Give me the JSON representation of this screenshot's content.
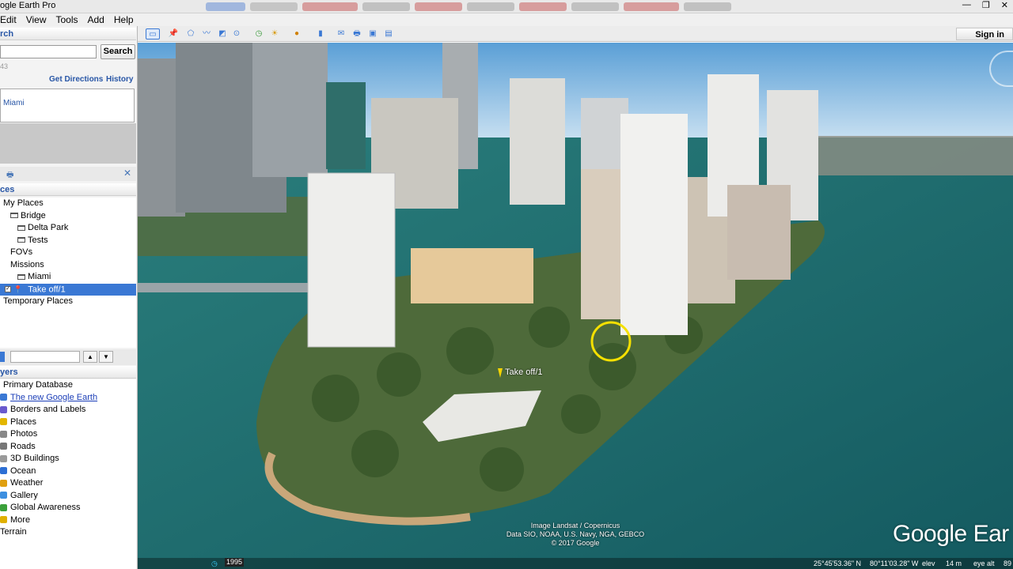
{
  "window": {
    "title": "ogle Earth Pro",
    "controls": [
      "—",
      "❐",
      "✕"
    ]
  },
  "menu": [
    "Edit",
    "View",
    "Tools",
    "Add",
    "Help"
  ],
  "search": {
    "header": "rch",
    "button": "Search",
    "query_value": "",
    "small_text": "43",
    "get_directions": "Get Directions",
    "history": "History",
    "result": "Miami"
  },
  "places": {
    "header": "ces",
    "items": [
      {
        "label": "My Places",
        "indent": 4,
        "icon": "none"
      },
      {
        "label": "Bridge",
        "indent": 13,
        "icon": "folder"
      },
      {
        "label": "Delta Park",
        "indent": 22,
        "icon": "folder"
      },
      {
        "label": "Tests",
        "indent": 22,
        "icon": "folder"
      },
      {
        "label": "FOVs",
        "indent": 13,
        "icon": "none"
      },
      {
        "label": "Missions",
        "indent": 13,
        "icon": "none"
      },
      {
        "label": "Miami",
        "indent": 22,
        "icon": "folder"
      },
      {
        "label": "Take off/1",
        "indent": 30,
        "icon": "pin",
        "selected": true
      },
      {
        "label": "Temporary Places",
        "indent": 4,
        "icon": "none"
      }
    ]
  },
  "layers": {
    "header": "yers",
    "items": [
      {
        "label": "Primary Database",
        "icon": "none",
        "color": ""
      },
      {
        "label": "The new Google Earth",
        "icon": "globe",
        "color": "#3a78d4",
        "link": true
      },
      {
        "label": "Borders and Labels",
        "icon": "borders",
        "color": "#6a5acd"
      },
      {
        "label": "Places",
        "icon": "places",
        "color": "#e3b600"
      },
      {
        "label": "Photos",
        "icon": "photos",
        "color": "#888888"
      },
      {
        "label": "Roads",
        "icon": "roads",
        "color": "#777777"
      },
      {
        "label": "3D Buildings",
        "icon": "buildings",
        "color": "#9a9a9a"
      },
      {
        "label": "Ocean",
        "icon": "ocean",
        "color": "#2d6fd4"
      },
      {
        "label": "Weather",
        "icon": "weather",
        "color": "#e0a010"
      },
      {
        "label": "Gallery",
        "icon": "gallery",
        "color": "#3d8fe0"
      },
      {
        "label": "Global Awareness",
        "icon": "awareness",
        "color": "#3aa03a"
      },
      {
        "label": "More",
        "icon": "more",
        "color": "#e0b000"
      },
      {
        "label": "Terrain",
        "icon": "none",
        "color": ""
      }
    ]
  },
  "toolbar": {
    "sign_in": "Sign in",
    "icons": [
      "sidebar-icon",
      "placemark-icon",
      "polygon-icon",
      "path-icon",
      "overlay-icon",
      "tour-icon",
      "historical-imagery-icon",
      "sun-icon",
      "planets-icon",
      "ruler-icon",
      "email-icon",
      "print-icon",
      "save-image-icon",
      "maps-icon"
    ]
  },
  "map": {
    "placemark_label": "Take off/1",
    "attribution": [
      "Image Landsat / Copernicus",
      "Data SIO, NOAA, U.S. Navy, NGA, GEBCO",
      "© 2017 Google"
    ],
    "logo": "Google Ear",
    "status": {
      "year": "1995",
      "coords": "25°45'53.36\" N",
      "lon": "80°11'03.28\" W",
      "elev_label": "elev",
      "elev_value": "14 m",
      "eye_label": "eye alt",
      "eye_value": "89"
    }
  }
}
